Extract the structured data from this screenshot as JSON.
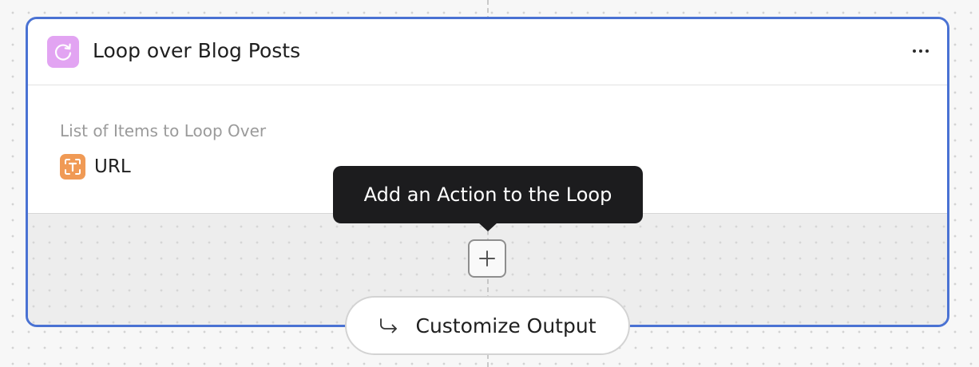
{
  "node": {
    "title": "Loop over Blog Posts",
    "icon": "loop-icon",
    "badge_color": "#e2a4f2",
    "accent_border": "#4a72d3"
  },
  "field": {
    "label": "List of Items to Loop Over",
    "value": "URL",
    "value_icon": "text-variable-icon",
    "value_icon_color": "#f09a55"
  },
  "tooltip": {
    "text": "Add an Action to the Loop"
  },
  "add_action": {
    "icon": "plus-icon"
  },
  "customize": {
    "label": "Customize Output",
    "icon": "arrow-turn-down-right-icon"
  },
  "menu": {
    "icon": "more-horizontal-icon"
  }
}
